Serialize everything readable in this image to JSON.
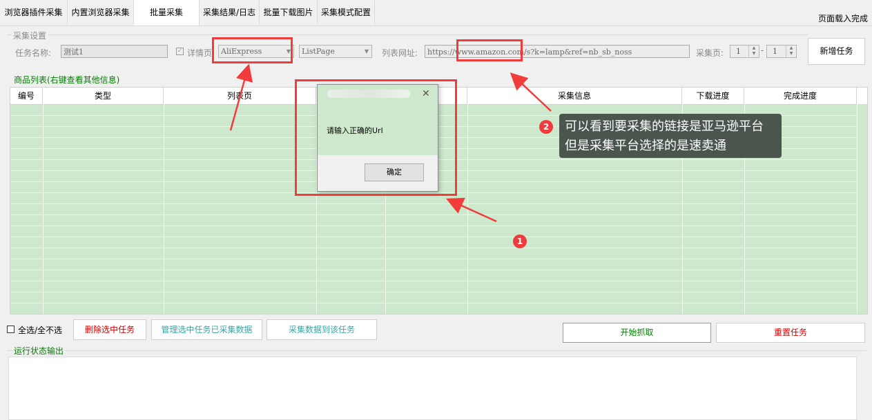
{
  "tabs": [
    {
      "label": "浏览器插件采集",
      "active": false
    },
    {
      "label": "内置浏览器采集",
      "active": false
    },
    {
      "label": "批量采集",
      "active": true
    },
    {
      "label": "采集结果/日志",
      "active": false
    },
    {
      "label": "批量下载图片",
      "active": false
    },
    {
      "label": "采集模式配置",
      "active": false
    }
  ],
  "status_right": "页面载入完成",
  "settings": {
    "group_title": "采集设置",
    "task_name_label": "任务名称:",
    "task_name_value": "测试1",
    "detail_checkbox_label": "详情页",
    "platform_select": "AliExpress",
    "page_type_select": "ListPage",
    "list_url_label": "列表网址:",
    "list_url_value": "https://www.amazon.com/s?k=lamp&ref=nb_sb_noss",
    "pages_label": "采集页:",
    "page_from": "1",
    "page_to": "1",
    "page_sep": "-",
    "add_task_button": "新增任务"
  },
  "grid": {
    "title": "商品列表(右键查看其他信息)",
    "columns": [
      "编号",
      "类型",
      "列表页",
      "",
      "务",
      "采集信息",
      "下载进度",
      "完成进度"
    ]
  },
  "dialog": {
    "message": "请输入正确的Url",
    "ok_label": "确定",
    "close_glyph": "✕"
  },
  "actions": {
    "select_all_label": "全选/全不选",
    "delete_selected": "删除选中任务",
    "manage_selected": "管理选中任务已采集数据",
    "collect_to_task": "采集数据到该任务",
    "start": "开始抓取",
    "reset": "重置任务"
  },
  "log": {
    "title": "运行状态输出"
  },
  "annotations": {
    "badge1": "1",
    "badge2": "2",
    "callout_line1": "可以看到要采集的链接是亚马逊平台",
    "callout_line2": "但是采集平台选择的是速卖通"
  },
  "colors": {
    "accent_green": "#008000",
    "red_text": "#d40000",
    "teal_text": "#3aa5a5",
    "annotation_red": "#f23b3b",
    "grid_green": "#cde8cd"
  }
}
